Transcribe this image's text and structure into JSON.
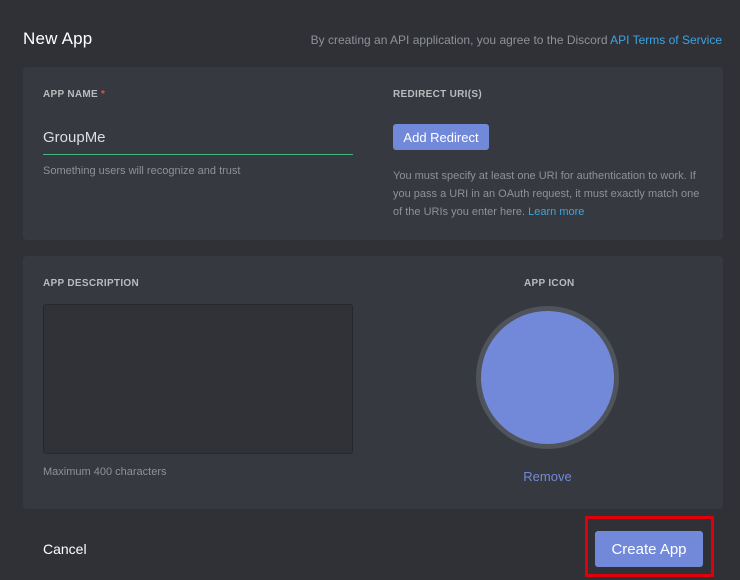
{
  "header": {
    "title": "New App",
    "terms_text": "By creating an API application, you agree to the Discord ",
    "terms_link": "API Terms of Service"
  },
  "app_name": {
    "label": "APP NAME",
    "required_mark": "*",
    "value": "GroupMe",
    "hint": "Something users will recognize and trust"
  },
  "redirects": {
    "label": "REDIRECT URI(S)",
    "add_label": "Add Redirect",
    "help_text": "You must specify at least one URI for authentication to work. If you pass a URI in an OAuth request, it must exactly match one of the URIs you enter here. ",
    "learn_more": "Learn more"
  },
  "description": {
    "label": "APP DESCRIPTION",
    "value": "",
    "hint": "Maximum 400 characters"
  },
  "app_icon": {
    "label": "APP ICON",
    "remove_label": "Remove",
    "color": "#7289da"
  },
  "footer": {
    "cancel_label": "Cancel",
    "create_label": "Create App"
  },
  "colors": {
    "background": "#2f3136",
    "panel": "#36393f",
    "accent": "#7289da",
    "link": "#3ba4e2",
    "input_underline": "#43b581",
    "required": "#f04747",
    "highlight": "#e0000c"
  }
}
